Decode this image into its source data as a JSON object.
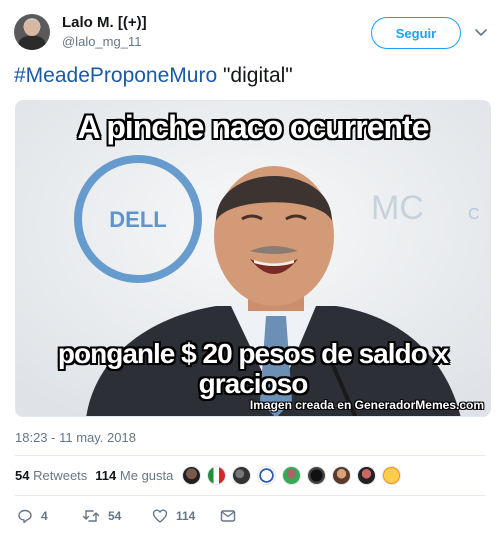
{
  "user": {
    "display_name": "Lalo M. [(+)]",
    "handle": "@lalo_mg_11",
    "follow_label": "Seguir"
  },
  "tweet": {
    "hashtag": "#MeadeProponeMuro",
    "text_rest": " \"digital\""
  },
  "media": {
    "top_caption": "A pinche naco ocurrente",
    "bottom_caption_line1": "ponganle $ 20 pesos de saldo x",
    "bottom_caption_line2": "gracioso",
    "watermark": "Imagen creada en GeneradorMemes.com",
    "background_logo": "DELL"
  },
  "meta": {
    "timestamp": "18:23 - 11 may. 2018"
  },
  "stats": {
    "retweets_count": "54",
    "retweets_label": "Retweets",
    "likes_count": "114",
    "likes_label": "Me gusta"
  },
  "actions": {
    "reply_count": "4",
    "retweet_count": "54",
    "like_count": "114"
  },
  "colors": {
    "accent": "#1da1f2",
    "hashtag": "#1b5aa8",
    "muted": "#657786"
  }
}
